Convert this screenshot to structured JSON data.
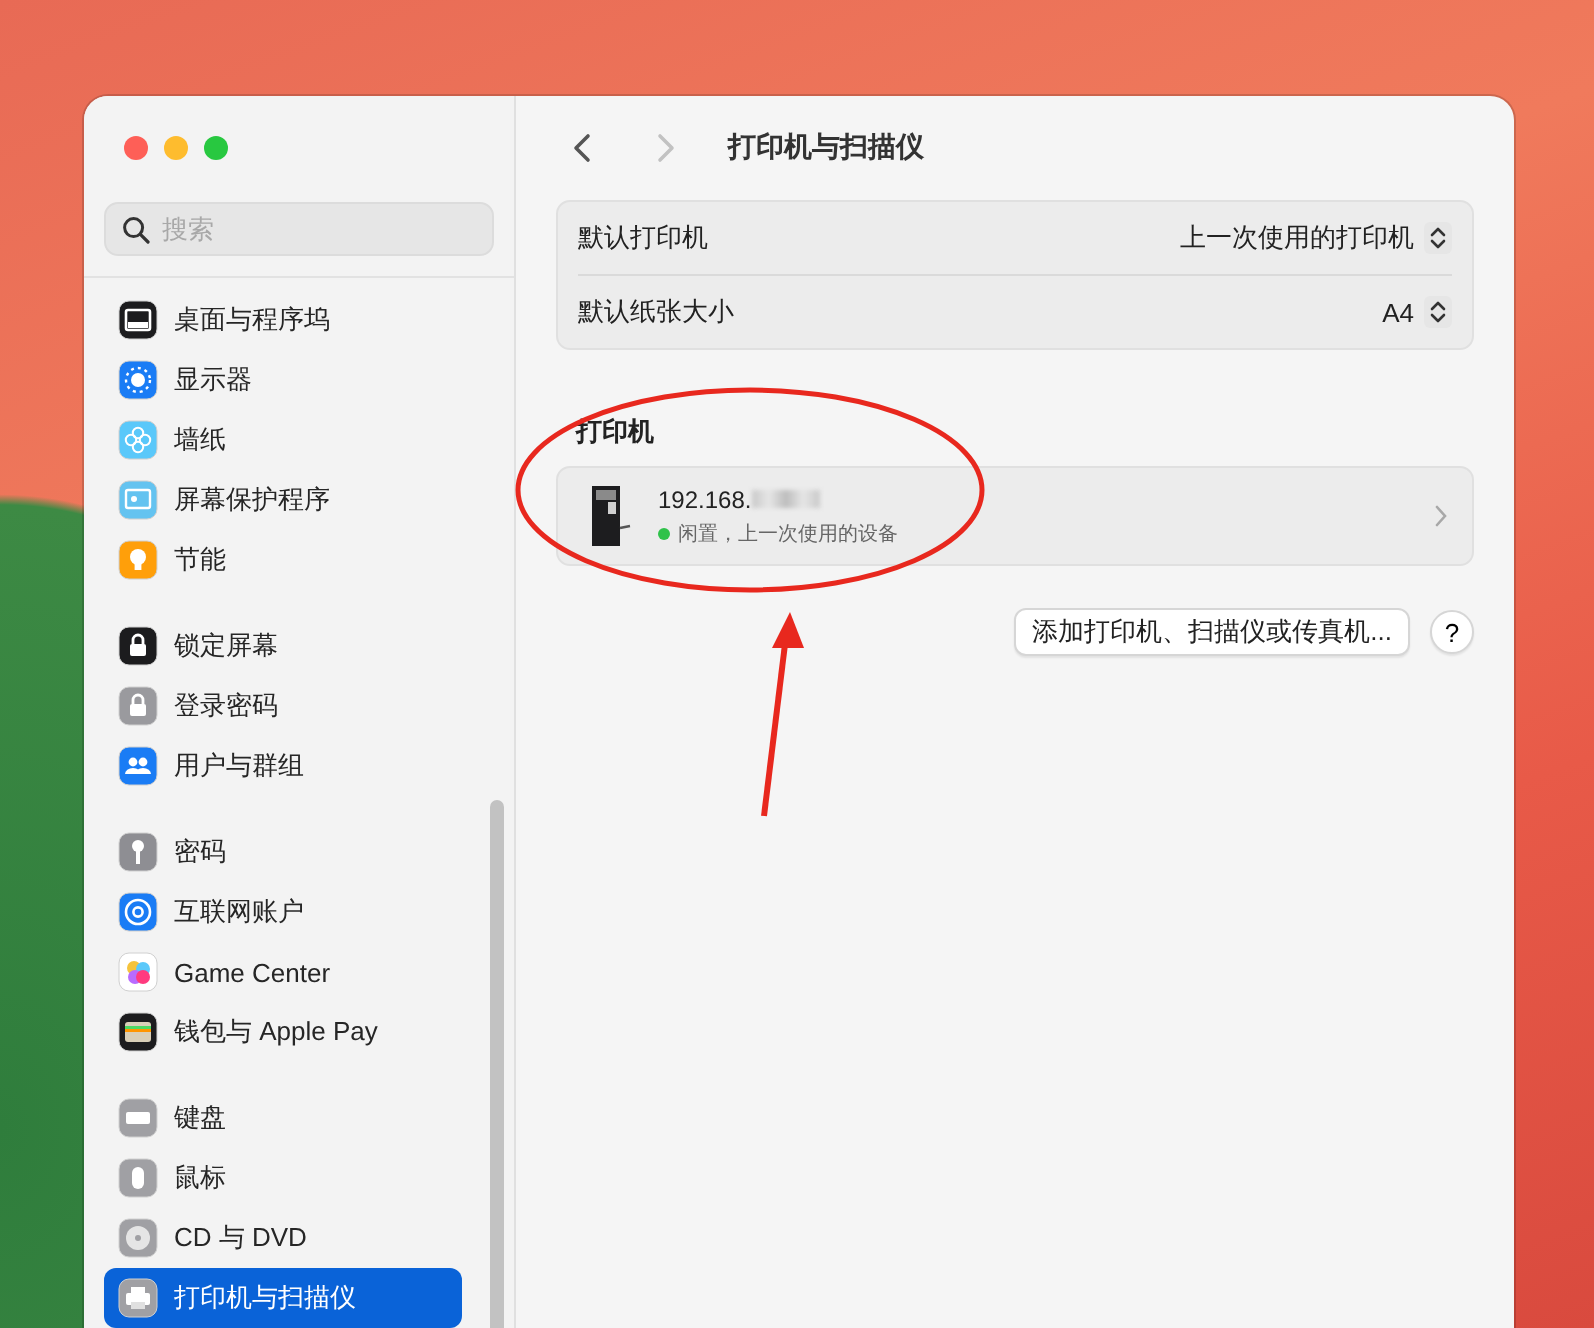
{
  "sidebar": {
    "search": {
      "placeholder": "搜索"
    },
    "groups": [
      {
        "items": [
          {
            "label": "桌面与程序坞",
            "selected": false
          },
          {
            "label": "显示器",
            "selected": false
          },
          {
            "label": "墙纸",
            "selected": false
          },
          {
            "label": "屏幕保护程序",
            "selected": false
          },
          {
            "label": "节能",
            "selected": false
          }
        ]
      },
      {
        "items": [
          {
            "label": "锁定屏幕",
            "selected": false
          },
          {
            "label": "登录密码",
            "selected": false
          },
          {
            "label": "用户与群组",
            "selected": false
          }
        ]
      },
      {
        "items": [
          {
            "label": "密码",
            "selected": false
          },
          {
            "label": "互联网账户",
            "selected": false
          },
          {
            "label": "Game Center",
            "selected": false
          },
          {
            "label": "钱包与 Apple Pay",
            "selected": false
          }
        ]
      },
      {
        "items": [
          {
            "label": "键盘",
            "selected": false
          },
          {
            "label": "鼠标",
            "selected": false
          },
          {
            "label": "CD 与 DVD",
            "selected": false
          },
          {
            "label": "打印机与扫描仪",
            "selected": true
          }
        ]
      }
    ]
  },
  "header": {
    "title": "打印机与扫描仪",
    "back": {
      "disabled": false
    },
    "forward": {
      "disabled": true
    }
  },
  "settings": [
    {
      "label": "默认打印机",
      "value": "上一次使用的打印机"
    },
    {
      "label": "默认纸张大小",
      "value": "A4"
    }
  ],
  "printers": {
    "title": "打印机",
    "items": [
      {
        "name": "192.168.",
        "name_redacted": true,
        "status": "闲置，上一次使用的设备"
      }
    ]
  },
  "buttons": {
    "add": "添加打印机、扫描仪或传真机...",
    "help": "?"
  }
}
